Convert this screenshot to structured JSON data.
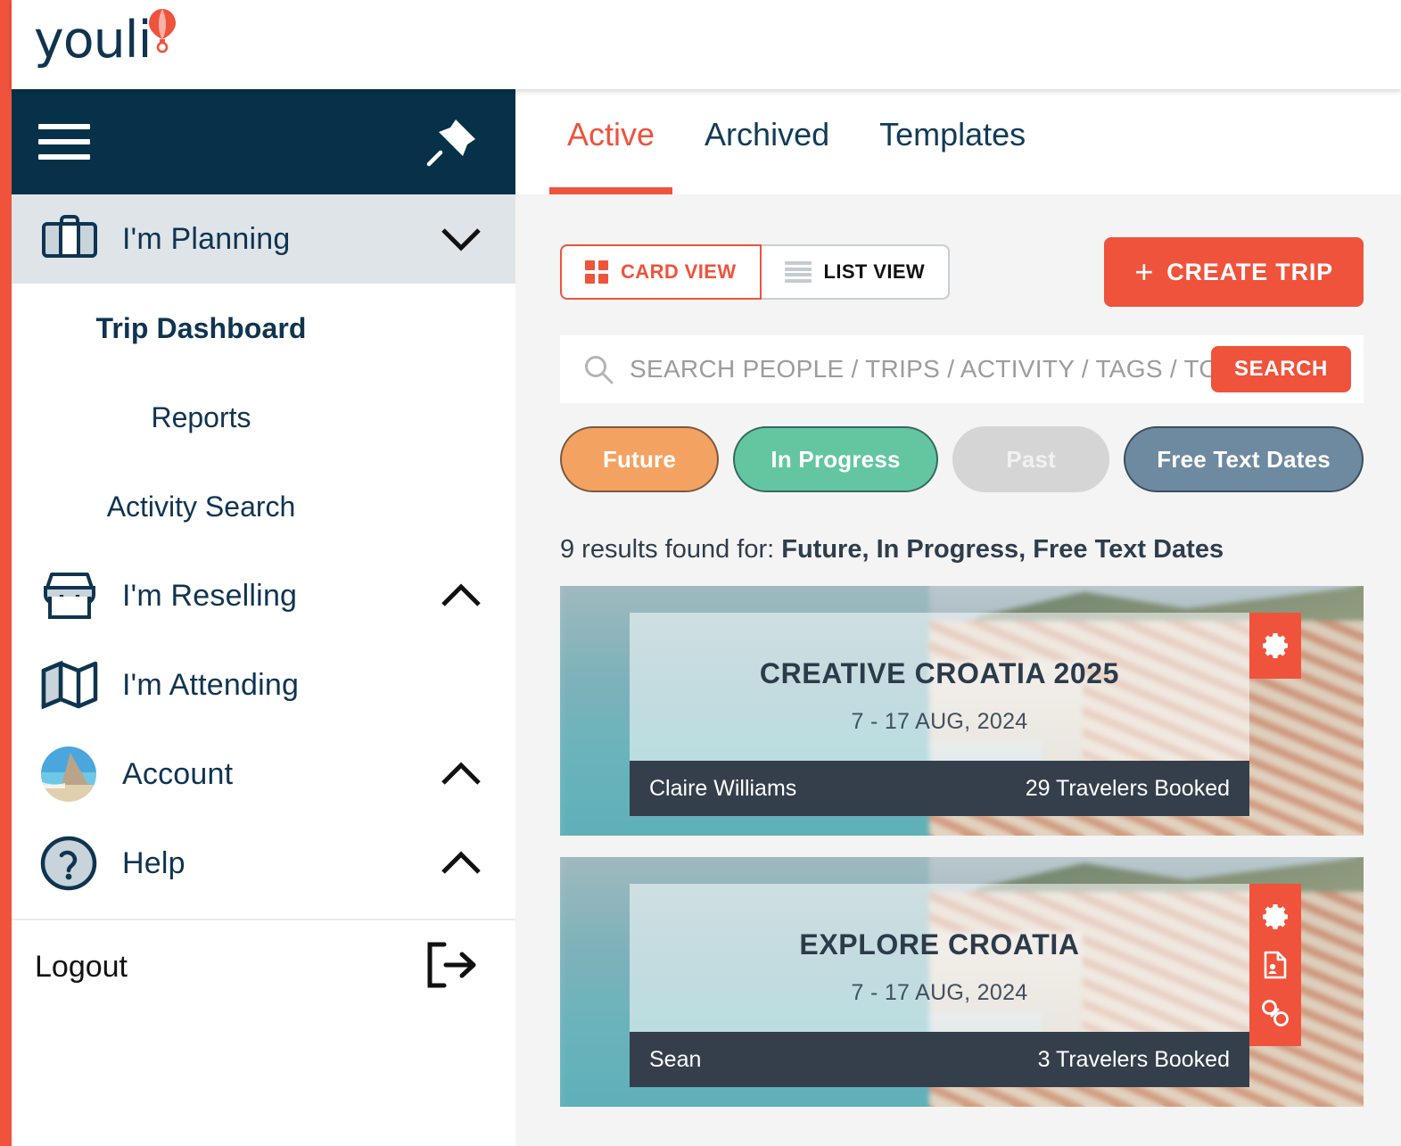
{
  "brand": {
    "logo_text": "youli",
    "accent_color": "#ef533c",
    "navy_color": "#063149"
  },
  "sidebar": {
    "header": {
      "menu_icon": "hamburger-icon",
      "pin_icon": "pin-icon"
    },
    "sections": [
      {
        "label": "I'm Planning",
        "icon": "suitcase-icon",
        "chevron": "chevron-down-icon",
        "expanded": true,
        "active": true,
        "children": [
          {
            "label": "Trip Dashboard",
            "selected": true
          },
          {
            "label": "Reports",
            "selected": false
          },
          {
            "label": "Activity Search",
            "selected": false
          }
        ]
      },
      {
        "label": "I'm Reselling",
        "icon": "storefront-icon",
        "chevron": "chevron-up-icon",
        "expanded": false,
        "active": false,
        "children": []
      },
      {
        "label": "I'm Attending",
        "icon": "map-icon",
        "chevron": "",
        "expanded": false,
        "active": false,
        "children": []
      },
      {
        "label": "Account",
        "icon": "avatar-photo",
        "chevron": "chevron-up-icon",
        "expanded": false,
        "active": false,
        "children": []
      },
      {
        "label": "Help",
        "icon": "question-circle-icon",
        "chevron": "chevron-up-icon",
        "expanded": false,
        "active": false,
        "children": []
      }
    ],
    "logout": {
      "label": "Logout",
      "icon": "logout-icon"
    }
  },
  "main": {
    "tabs": [
      {
        "label": "Active",
        "active": true
      },
      {
        "label": "Archived",
        "active": false
      },
      {
        "label": "Templates",
        "active": false
      }
    ],
    "view_toggle": {
      "card_view_label": "CARD VIEW",
      "list_view_label": "LIST VIEW",
      "selected": "CARD VIEW"
    },
    "create_trip": {
      "plus": "+",
      "label": "CREATE TRIP"
    },
    "search": {
      "placeholder": "SEARCH PEOPLE / TRIPS / ACTIVITY / TAGS / TO",
      "value": "",
      "button_label": "SEARCH",
      "icon": "search-icon"
    },
    "filter_pills": [
      {
        "label": "Future",
        "color": "#f4a261",
        "selected": true
      },
      {
        "label": "In Progress",
        "color": "#63c6a0",
        "selected": true
      },
      {
        "label": "Past",
        "color": "#d5d5d5",
        "selected": false
      },
      {
        "label": "Free Text Dates",
        "color": "#6e8aa0",
        "selected": true
      }
    ],
    "results_prefix": "9 results found for:",
    "results_filters": "Future, In Progress, Free Text Dates",
    "trips": [
      {
        "title": "CREATIVE CROATIA 2025",
        "dates": "7 - 17 AUG, 2024",
        "organizer": "Claire Williams",
        "travelers": "29 Travelers Booked",
        "actions": [
          "gear-icon"
        ]
      },
      {
        "title": "EXPLORE CROATIA",
        "dates": "7 - 17 AUG, 2024",
        "organizer": "Sean",
        "travelers": "3 Travelers Booked",
        "actions": [
          "gear-icon",
          "document-person-icon",
          "link-chain-icon"
        ]
      }
    ]
  }
}
